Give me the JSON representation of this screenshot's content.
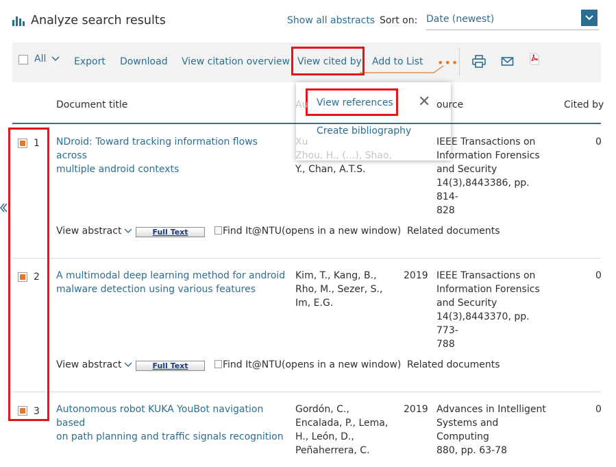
{
  "header": {
    "title": "Analyze search results",
    "show_all_abstracts": "Show all abstracts",
    "sort_label": "Sort on:",
    "sort_value": "Date (newest)"
  },
  "toolbar": {
    "all_label": "All",
    "export": "Export",
    "download": "Download",
    "view_citation_overview": "View citation overview",
    "view_cited_by": "View cited by",
    "add_to_list": "Add to List",
    "more": "•••",
    "print_icon": "print-icon",
    "email_icon": "email-icon",
    "pdf_icon": "pdf-icon"
  },
  "popup": {
    "view_references": "View references",
    "create_bibliography": "Create bibliography",
    "close": "✕"
  },
  "table": {
    "headers": {
      "document_title": "Document title",
      "authors": "Au",
      "source": "ource",
      "cited_by": "Cited by"
    },
    "rows": [
      {
        "num": "1",
        "title_lines": [
          "NDroid: Toward tracking information flows across",
          "multiple android contexts"
        ],
        "authors_lines": [
          "Xu",
          "Zhou, H., (...), Shao,",
          "Y., Chan, A.T.S."
        ],
        "year": "",
        "source_lines": [
          "IEEE Transactions on",
          "Information Forensics",
          "and Security",
          "14(3),8443386, pp. 814-",
          "828"
        ],
        "cited": "0"
      },
      {
        "num": "2",
        "title_lines": [
          "A multimodal deep learning method for android",
          "malware detection using various features"
        ],
        "authors_lines": [
          "Kim, T., Kang, B.,",
          "Rho, M., Sezer, S.,",
          "Im, E.G."
        ],
        "year": "2019",
        "source_lines": [
          "IEEE Transactions on",
          "Information Forensics",
          "and Security",
          "14(3),8443370, pp. 773-",
          "788"
        ],
        "cited": "0"
      },
      {
        "num": "3",
        "title_lines": [
          "Autonomous robot KUKA YouBot navigation based",
          "on path planning and traffic signals recognition"
        ],
        "authors_lines": [
          "Gordón, C.,",
          "Encalada, P., Lema,",
          "H., León, D.,",
          "Peñaherrera, C."
        ],
        "year": "2019",
        "source_lines": [
          "Advances in Intelligent",
          "Systems and Computing",
          "880, pp. 63-78"
        ],
        "cited": "0"
      }
    ],
    "actions": {
      "view_abstract": "View abstract",
      "full_text": "Full Text",
      "find_it": "Find It@NTU(opens in a new window)",
      "related": "Related documents"
    }
  },
  "colors": {
    "accent": "#2c6e8f",
    "highlight": "#e5141a",
    "checkbox": "#e87722"
  }
}
